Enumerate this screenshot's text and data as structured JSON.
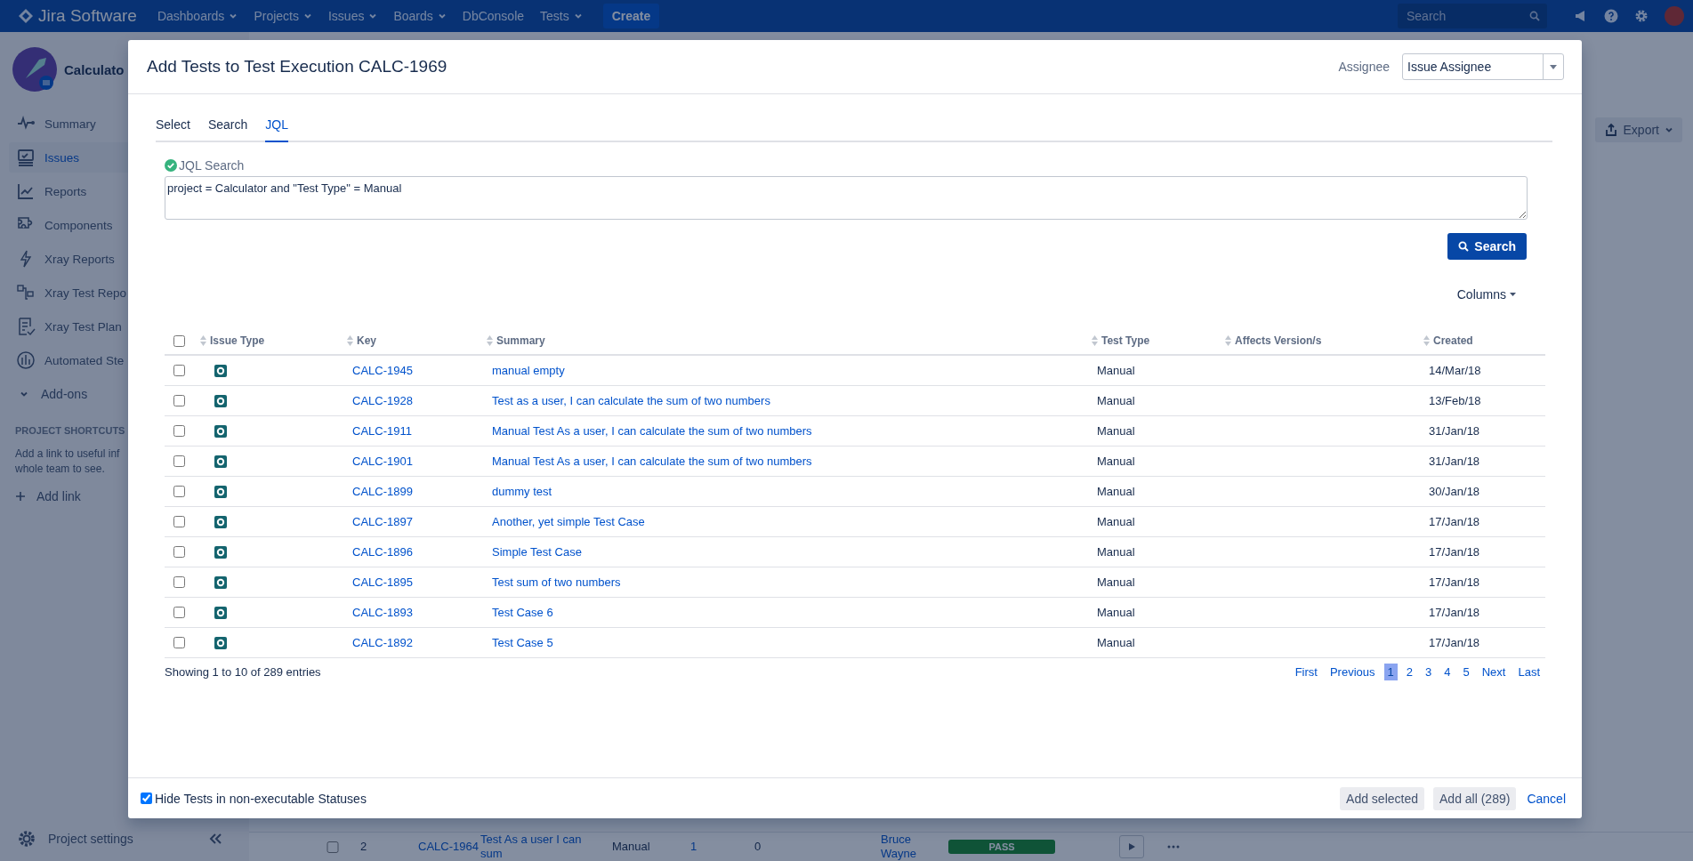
{
  "top_nav": {
    "product": "Jira Software",
    "menus": [
      {
        "label": "Dashboards",
        "dropdown": true
      },
      {
        "label": "Projects",
        "dropdown": true
      },
      {
        "label": "Issues",
        "dropdown": true
      },
      {
        "label": "Boards",
        "dropdown": true
      },
      {
        "label": "DbConsole",
        "dropdown": false
      },
      {
        "label": "Tests",
        "dropdown": true
      }
    ],
    "create_button": "Create",
    "search": {
      "placeholder": "Search"
    }
  },
  "sidebar": {
    "project_name": "Calculato",
    "items": [
      {
        "label": "Summary",
        "selected": false
      },
      {
        "label": "Issues",
        "selected": true
      },
      {
        "label": "Reports",
        "selected": false
      },
      {
        "label": "Components",
        "selected": false
      },
      {
        "label": "Xray Reports",
        "selected": false
      },
      {
        "label": "Xray Test Repo",
        "selected": false
      },
      {
        "label": "Xray Test Plan",
        "selected": false
      },
      {
        "label": "Automated Ste",
        "selected": false
      }
    ],
    "add_ons": "Add-ons",
    "shortcuts_heading": "PROJECT SHORTCUTS",
    "shortcuts_text": [
      "Add a link to useful inf",
      "whole team to see."
    ],
    "add_link": "Add link",
    "project_settings": "Project settings"
  },
  "page": {
    "export_button": "Export",
    "background_row": {
      "checked": false,
      "number": "2",
      "key": "CALC-1964",
      "summary": "Test As a user I can sum",
      "test_type": "Manual",
      "column_5": "1",
      "column_6": "0",
      "assignee": "Bruce Wayne",
      "status": "PASS"
    }
  },
  "dialog": {
    "title": "Add Tests to Test Execution CALC-1969",
    "assignee_label": "Assignee",
    "assignee_value": "Issue Assignee",
    "tabs": [
      {
        "label": "Select",
        "selected": false
      },
      {
        "label": "Search",
        "selected": false
      },
      {
        "label": "JQL",
        "selected": true
      }
    ],
    "jql_label": "JQL Search",
    "jql_query": "project = Calculator and \"Test Type\" = Manual",
    "search_button": "Search",
    "columns_button": "Columns",
    "table": {
      "select_all_checked": false,
      "columns": [
        "Issue Type",
        "Key",
        "Summary",
        "Test Type",
        "Affects Version/s",
        "Created"
      ],
      "rows": [
        {
          "checked": false,
          "key": "CALC-1945",
          "summary": "manual empty",
          "test_type": "Manual",
          "created": "14/Mar/18"
        },
        {
          "checked": false,
          "key": "CALC-1928",
          "summary": "Test as a user, I can calculate the sum of two numbers",
          "test_type": "Manual",
          "created": "13/Feb/18"
        },
        {
          "checked": false,
          "key": "CALC-1911",
          "summary": "Manual Test As a user, I can calculate the sum of two numbers",
          "test_type": "Manual",
          "created": "31/Jan/18"
        },
        {
          "checked": false,
          "key": "CALC-1901",
          "summary": "Manual Test As a user, I can calculate the sum of two numbers",
          "test_type": "Manual",
          "created": "31/Jan/18"
        },
        {
          "checked": false,
          "key": "CALC-1899",
          "summary": "dummy test",
          "test_type": "Manual",
          "created": "30/Jan/18"
        },
        {
          "checked": false,
          "key": "CALC-1897",
          "summary": "Another, yet simple Test Case",
          "test_type": "Manual",
          "created": "17/Jan/18"
        },
        {
          "checked": false,
          "key": "CALC-1896",
          "summary": "Simple Test Case",
          "test_type": "Manual",
          "created": "17/Jan/18"
        },
        {
          "checked": false,
          "key": "CALC-1895",
          "summary": "Test sum of two numbers",
          "test_type": "Manual",
          "created": "17/Jan/18"
        },
        {
          "checked": false,
          "key": "CALC-1893",
          "summary": "Test Case 6",
          "test_type": "Manual",
          "created": "17/Jan/18"
        },
        {
          "checked": false,
          "key": "CALC-1892",
          "summary": "Test Case 5",
          "test_type": "Manual",
          "created": "17/Jan/18"
        }
      ]
    },
    "showing": "Showing 1 to 10 of 289 entries",
    "pagination": {
      "first": "First",
      "previous": "Previous",
      "pages": [
        {
          "label": "1",
          "selected": true
        },
        {
          "label": "2",
          "selected": false
        },
        {
          "label": "3",
          "selected": false
        },
        {
          "label": "4",
          "selected": false
        },
        {
          "label": "5",
          "selected": false
        }
      ],
      "next": "Next",
      "last": "Last"
    },
    "hide_checkbox": {
      "label": "Hide Tests in non-executable Statuses",
      "checked": true
    },
    "add_selected_button": "Add selected",
    "add_all_button": "Add all (289)",
    "cancel_link": "Cancel"
  }
}
